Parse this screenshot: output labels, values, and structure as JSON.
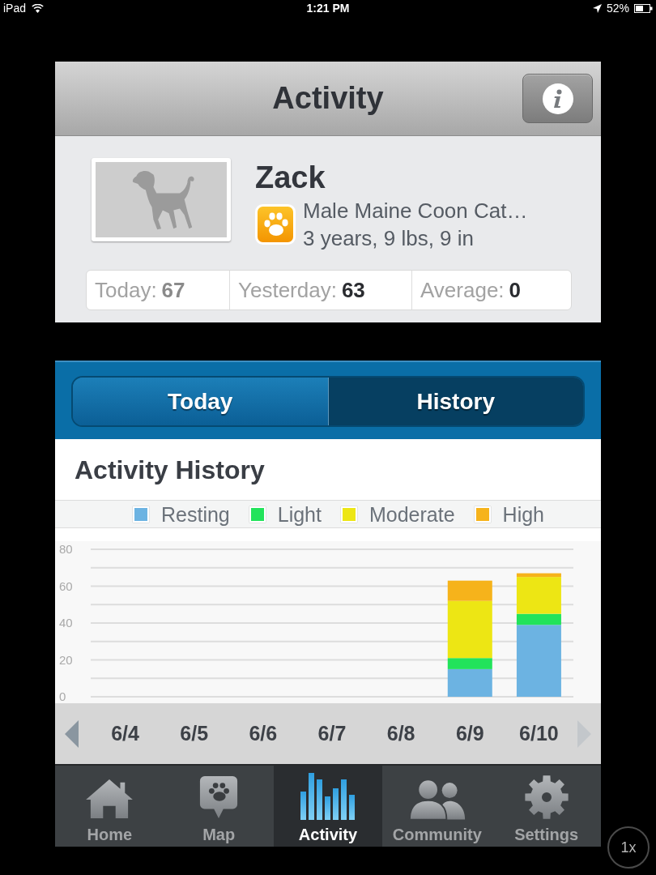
{
  "status_bar": {
    "device": "iPad",
    "time": "1:21 PM",
    "battery": "52%"
  },
  "nav_bar": {
    "title": "Activity"
  },
  "profile": {
    "name": "Zack",
    "breed": "Male Maine Coon Cat…",
    "details": "3 years, 9 lbs, 9 in"
  },
  "stats": [
    {
      "label": "Today:",
      "value": "67",
      "muted": true
    },
    {
      "label": "Yesterday:",
      "value": "63",
      "muted": false
    },
    {
      "label": "Average:",
      "value": "0",
      "muted": false
    }
  ],
  "view_tabs": [
    {
      "label": "Today",
      "selected": false
    },
    {
      "label": "History",
      "selected": true
    }
  ],
  "chart_data": {
    "type": "bar",
    "title": "Activity History",
    "categories": [
      "6/4",
      "6/5",
      "6/6",
      "6/7",
      "6/8",
      "6/9",
      "6/10"
    ],
    "series": [
      {
        "name": "Resting",
        "color": "#6cb3e2",
        "values": [
          null,
          null,
          null,
          null,
          null,
          15,
          39
        ]
      },
      {
        "name": "Light",
        "color": "#22e35b",
        "values": [
          null,
          null,
          null,
          null,
          null,
          6,
          6
        ]
      },
      {
        "name": "Moderate",
        "color": "#ede614",
        "values": [
          null,
          null,
          null,
          null,
          null,
          31,
          20
        ]
      },
      {
        "name": "High",
        "color": "#f6b31b",
        "values": [
          null,
          null,
          null,
          null,
          null,
          11,
          2
        ]
      }
    ],
    "ylim": [
      0,
      80
    ],
    "yticks": [
      {
        "value": 0,
        "label": "0"
      },
      {
        "value": 20,
        "label": "20"
      },
      {
        "value": 40,
        "label": "40"
      },
      {
        "value": 60,
        "label": "60"
      },
      {
        "value": 80,
        "label": "80"
      }
    ],
    "stacked": true,
    "grid": true,
    "legend": true
  },
  "pager": {
    "previous": {
      "disabled": false
    },
    "next": {
      "disabled": true
    }
  },
  "tab_bar": [
    {
      "label": "Home",
      "kind": "home",
      "selected": false
    },
    {
      "label": "Map",
      "kind": "map",
      "selected": false
    },
    {
      "label": "Activity",
      "kind": "activity",
      "selected": true
    },
    {
      "label": "Community",
      "kind": "community",
      "selected": false
    },
    {
      "label": "Settings",
      "kind": "settings",
      "selected": false
    }
  ],
  "zoom_button": "1x"
}
